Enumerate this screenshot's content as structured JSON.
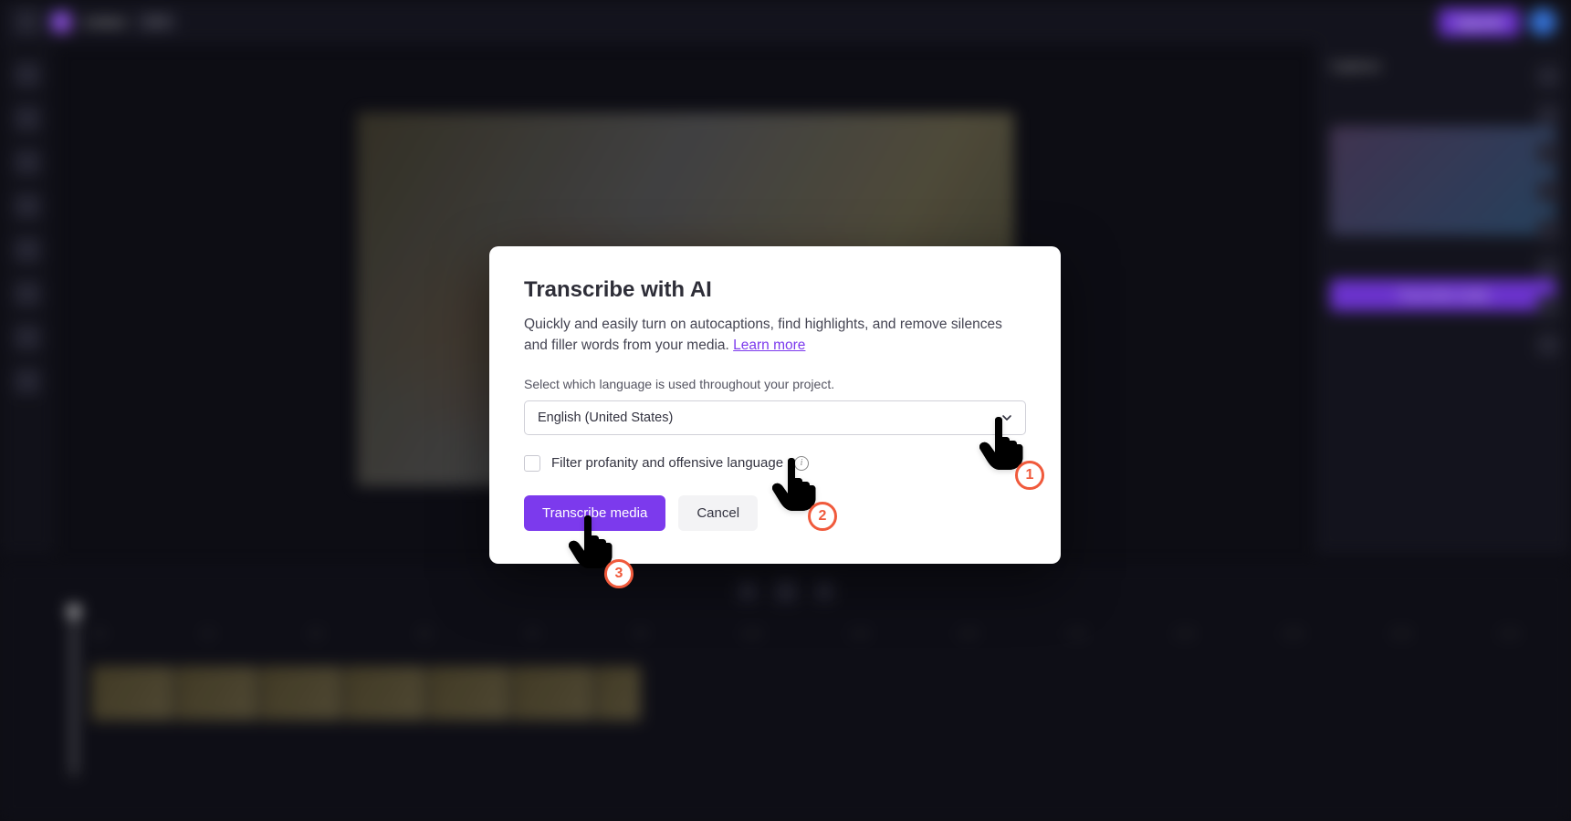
{
  "topbar": {
    "project_name": "Untitled",
    "aspect_ratio": "16:9",
    "upgrade_label": "Upgrade"
  },
  "right_panel": {
    "tab_label": "Captions",
    "button_label": "Transcribe media"
  },
  "modal": {
    "title": "Transcribe with AI",
    "description": "Quickly and easily turn on autocaptions, find highlights, and remove silences and filler words from your media.",
    "learn_more": "Learn more",
    "language_label": "Select which language is used throughout your project.",
    "language_value": "English (United States)",
    "filter_label": "Filter profanity and offensive language",
    "primary_btn": "Transcribe media",
    "cancel_btn": "Cancel"
  },
  "timeline": {
    "ticks": [
      ":00",
      ":10",
      ":20",
      ":30",
      ":40",
      ":50",
      "1:00",
      "1:10",
      "1:20",
      "1:30",
      "1:40",
      "1:50",
      "2:00",
      "2:10"
    ]
  },
  "annotations": {
    "step1": "1",
    "step2": "2",
    "step3": "3"
  },
  "colors": {
    "accent": "#7c3aed",
    "annotation": "#f05a3c"
  }
}
